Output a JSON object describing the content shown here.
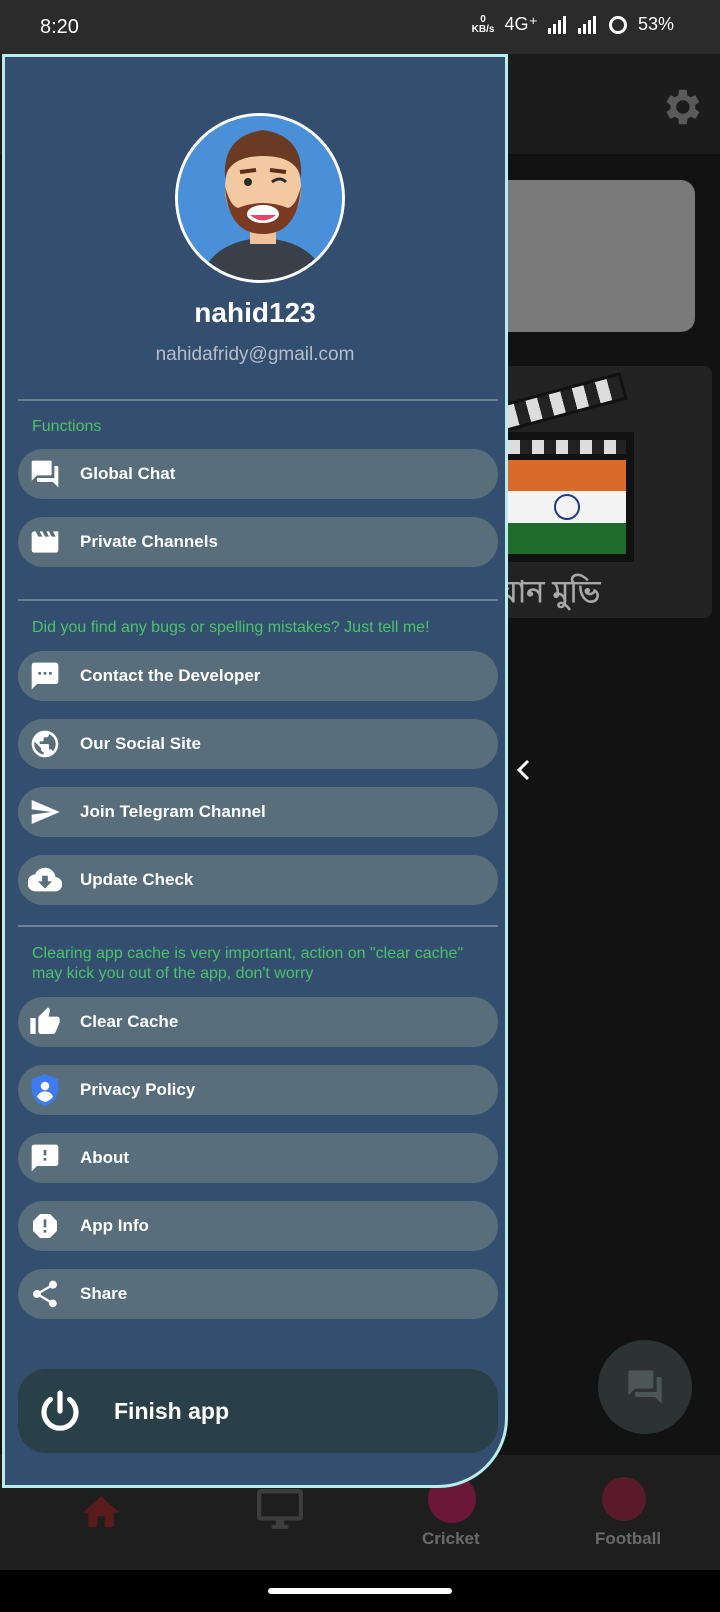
{
  "status_bar": {
    "time": "8:20",
    "data_rate_value": "0",
    "data_rate_unit": "KB/s",
    "network": "4G⁺",
    "battery": "53%"
  },
  "background": {
    "card_text": "য়ান মুভি"
  },
  "bottom_nav": {
    "items": [
      {
        "label": ""
      },
      {
        "label": ""
      },
      {
        "label": "Cricket"
      },
      {
        "label": "Football"
      }
    ]
  },
  "drawer": {
    "username": "nahid123",
    "email": "nahidafridy@gmail.com",
    "sections": [
      "Functions",
      "Did you find any bugs or spelling mistakes? Just tell me!",
      "Clearing app cache is very important, action on \"clear cache\" may kick you out of the app, don't worry"
    ],
    "items": [
      {
        "label": "Global Chat",
        "icon": "forum-icon"
      },
      {
        "label": "Private Channels",
        "icon": "movie-icon"
      },
      {
        "label": "Contact the Developer",
        "icon": "message-icon"
      },
      {
        "label": "Our Social Site",
        "icon": "globe-icon"
      },
      {
        "label": "Join Telegram Channel",
        "icon": "send-icon"
      },
      {
        "label": "Update Check",
        "icon": "cloud-download-icon"
      },
      {
        "label": "Clear Cache",
        "icon": "thumb-up-icon"
      },
      {
        "label": "Privacy Policy",
        "icon": "shield-user-icon"
      },
      {
        "label": "About",
        "icon": "feedback-icon"
      },
      {
        "label": "App Info",
        "icon": "alert-octagon-icon"
      },
      {
        "label": "Share",
        "icon": "share-icon"
      }
    ],
    "finish_label": "Finish app"
  },
  "colors": {
    "drawer_bg": "#344e6f",
    "item_bg": "#586e7b",
    "section_text": "#4cc26a",
    "border": "#b7ecea"
  }
}
